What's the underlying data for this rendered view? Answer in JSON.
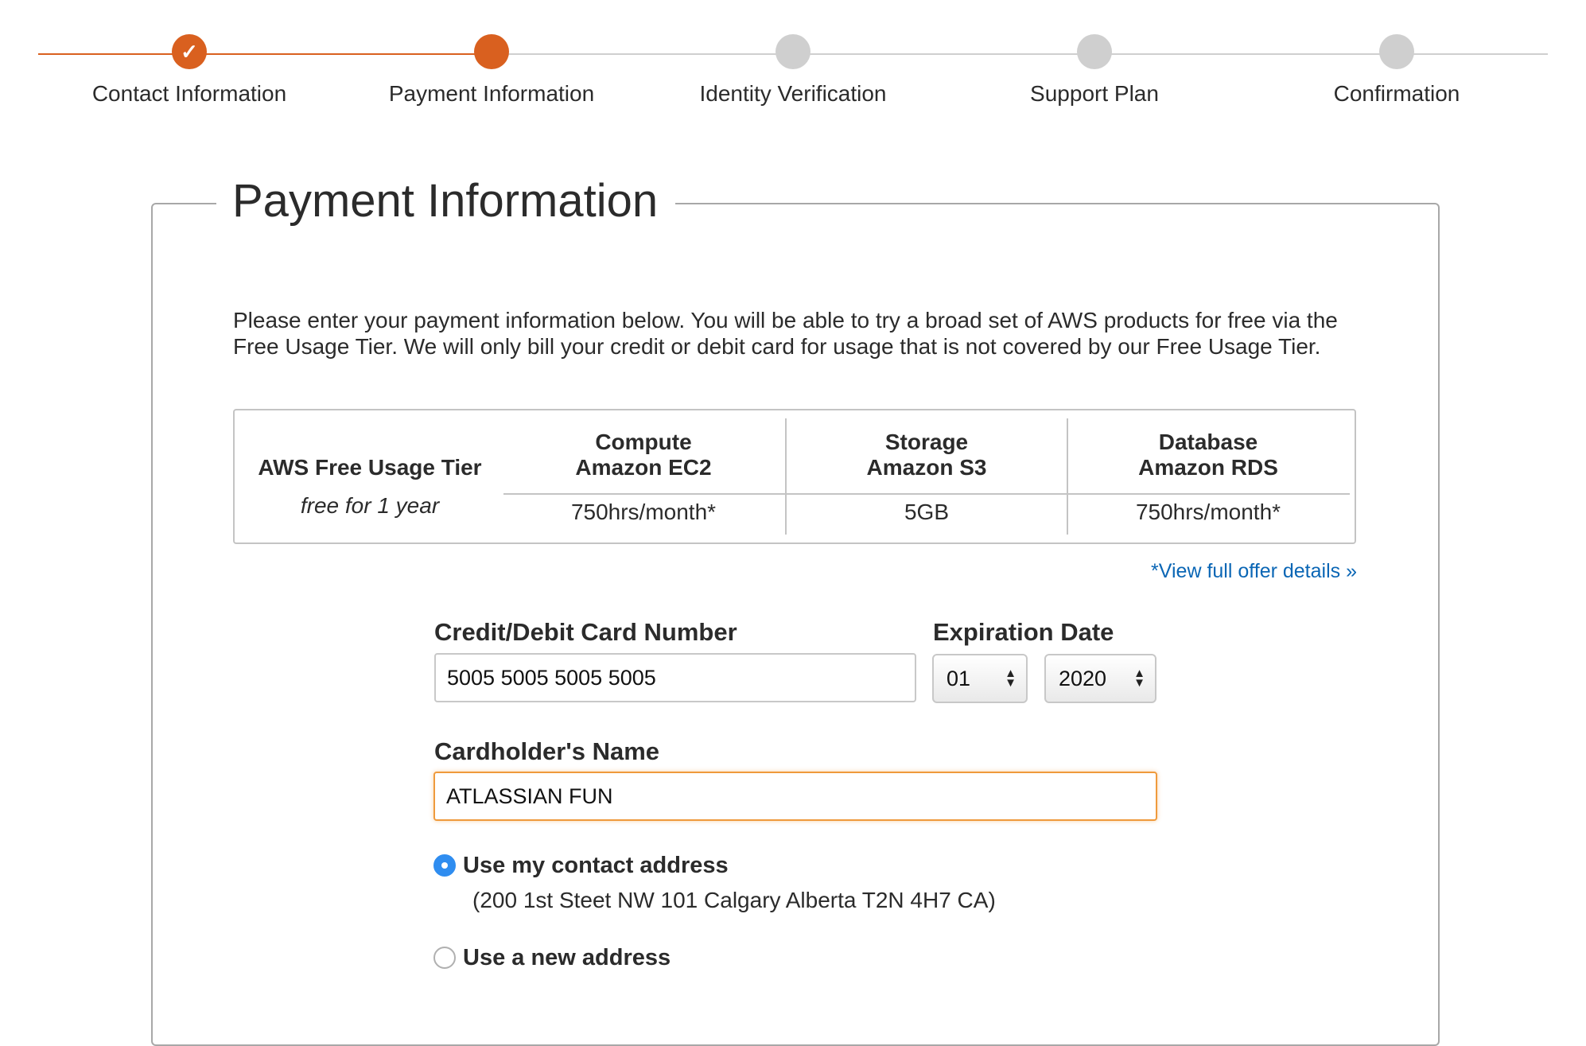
{
  "stepper": {
    "steps": [
      {
        "label": "Contact Information",
        "state": "done"
      },
      {
        "label": "Payment Information",
        "state": "active"
      },
      {
        "label": "Identity Verification",
        "state": "todo"
      },
      {
        "label": "Support Plan",
        "state": "todo"
      },
      {
        "label": "Confirmation",
        "state": "todo"
      }
    ],
    "check_glyph": "✓"
  },
  "colors": {
    "accent": "#d9601f",
    "inactive_step": "#cfcfcf",
    "link": "#0a66b5",
    "focus_border": "#ef9a3c",
    "radio_selected": "#2f8df0"
  },
  "panel": {
    "title": "Payment Information",
    "intro": "Please enter your payment information below. You will be able to try a broad set of AWS products for free via the Free Usage Tier. We will only bill your credit or debit card for usage that is not covered by our Free Usage Tier."
  },
  "free_tier": {
    "name": "AWS Free Usage Tier",
    "subtitle": "free for 1 year",
    "columns": [
      {
        "category": "Compute",
        "product": "Amazon EC2",
        "value": "750hrs/month*"
      },
      {
        "category": "Storage",
        "product": "Amazon S3",
        "value": "5GB"
      },
      {
        "category": "Database",
        "product": "Amazon RDS",
        "value": "750hrs/month*"
      }
    ],
    "offer_link": "*View full offer details »"
  },
  "form": {
    "card_number_label": "Credit/Debit Card Number",
    "card_number_value": "5005 5005 5005 5005",
    "expiration_label": "Expiration Date",
    "exp_month": "01",
    "exp_year": "2020",
    "cardholder_label": "Cardholder's Name",
    "cardholder_value": "ATLASSIAN FUN",
    "address_options": [
      {
        "label": "Use my contact address",
        "selected": true,
        "detail": "(200 1st Steet NW 101 Calgary Alberta T2N 4H7 CA)"
      },
      {
        "label": "Use a new address",
        "selected": false
      }
    ]
  }
}
